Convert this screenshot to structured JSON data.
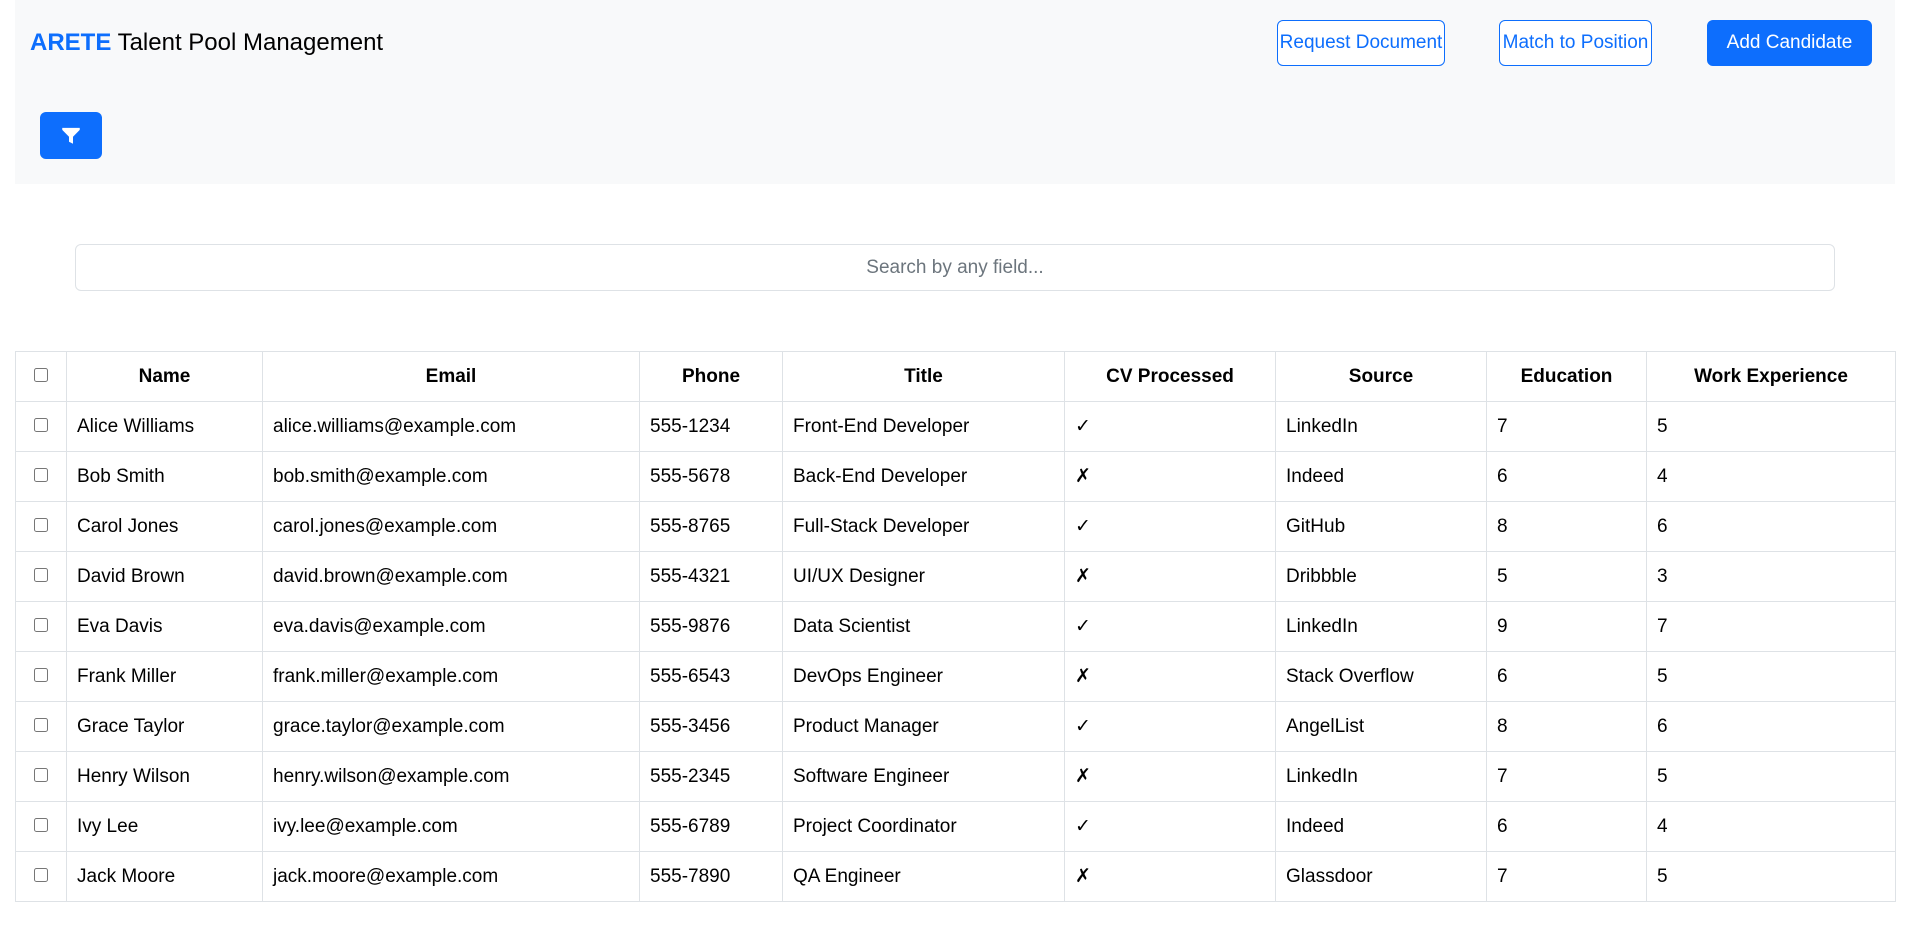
{
  "header": {
    "brand_accent": "ARETE",
    "brand_rest": "Talent Pool Management",
    "buttons": {
      "request_document": "Request Document",
      "match_to_position": "Match to Position",
      "add_candidate": "Add Candidate"
    },
    "filter_icon": "filter-icon"
  },
  "search": {
    "placeholder": "Search by any field..."
  },
  "table": {
    "headers": [
      "Name",
      "Email",
      "Phone",
      "Title",
      "CV Processed",
      "Source",
      "Education",
      "Work Experience"
    ],
    "rows": [
      {
        "name": "Alice Williams",
        "email": "alice.williams@example.com",
        "phone": "555-1234",
        "title": "Front-End Developer",
        "cv": "✓",
        "source": "LinkedIn",
        "education": "7",
        "experience": "5"
      },
      {
        "name": "Bob Smith",
        "email": "bob.smith@example.com",
        "phone": "555-5678",
        "title": "Back-End Developer",
        "cv": "✗",
        "source": "Indeed",
        "education": "6",
        "experience": "4"
      },
      {
        "name": "Carol Jones",
        "email": "carol.jones@example.com",
        "phone": "555-8765",
        "title": "Full-Stack Developer",
        "cv": "✓",
        "source": "GitHub",
        "education": "8",
        "experience": "6"
      },
      {
        "name": "David Brown",
        "email": "david.brown@example.com",
        "phone": "555-4321",
        "title": "UI/UX Designer",
        "cv": "✗",
        "source": "Dribbble",
        "education": "5",
        "experience": "3"
      },
      {
        "name": "Eva Davis",
        "email": "eva.davis@example.com",
        "phone": "555-9876",
        "title": "Data Scientist",
        "cv": "✓",
        "source": "LinkedIn",
        "education": "9",
        "experience": "7"
      },
      {
        "name": "Frank Miller",
        "email": "frank.miller@example.com",
        "phone": "555-6543",
        "title": "DevOps Engineer",
        "cv": "✗",
        "source": "Stack Overflow",
        "education": "6",
        "experience": "5"
      },
      {
        "name": "Grace Taylor",
        "email": "grace.taylor@example.com",
        "phone": "555-3456",
        "title": "Product Manager",
        "cv": "✓",
        "source": "AngelList",
        "education": "8",
        "experience": "6"
      },
      {
        "name": "Henry Wilson",
        "email": "henry.wilson@example.com",
        "phone": "555-2345",
        "title": "Software Engineer",
        "cv": "✗",
        "source": "LinkedIn",
        "education": "7",
        "experience": "5"
      },
      {
        "name": "Ivy Lee",
        "email": "ivy.lee@example.com",
        "phone": "555-6789",
        "title": "Project Coordinator",
        "cv": "✓",
        "source": "Indeed",
        "education": "6",
        "experience": "4"
      },
      {
        "name": "Jack Moore",
        "email": "jack.moore@example.com",
        "phone": "555-7890",
        "title": "QA Engineer",
        "cv": "✗",
        "source": "Glassdoor",
        "education": "7",
        "experience": "5"
      }
    ]
  },
  "colors": {
    "accent": "#0d6efd",
    "header_bg": "#f8f9fa",
    "border": "#dee2e6"
  }
}
